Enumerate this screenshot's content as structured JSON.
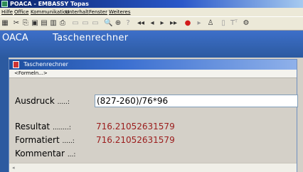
{
  "window": {
    "title": "POACA - EMBASSY Topas"
  },
  "menubar": {
    "items": [
      "Hilfe",
      "Office",
      "Kommunikation",
      "Unterhalt",
      "Fenster",
      "Weiteres"
    ]
  },
  "toolbar": {
    "icons": [
      "grid-icon",
      "cut-icon",
      "copy-icon",
      "paste-icon",
      "table-icon",
      "chart-icon",
      "print-icon",
      "window1-icon",
      "window2-icon",
      "window3-icon",
      "search-icon",
      "zoom-icon",
      "help-icon",
      "first-icon",
      "prev-icon",
      "next-icon",
      "last-icon",
      "record-icon",
      "play-icon",
      "user-icon",
      "doc-icon",
      "text-icon",
      "settings-icon"
    ],
    "glyphs": [
      "▦",
      "✂",
      "⎘",
      "▣",
      "▤",
      "▥",
      "⎙",
      "▭",
      "▭",
      "▭",
      "🔍",
      "⊕",
      "?",
      "◂◂",
      "◂",
      "▸",
      "▸▸",
      "●",
      "▸",
      "♙",
      "▯",
      "Tᵀ",
      "⚙"
    ]
  },
  "app_header": {
    "code": "OACA",
    "title": "Taschenrechner"
  },
  "dialog": {
    "title": "Taschenrechner",
    "menu": "<Formeln...>",
    "expression_label": "Ausdruck",
    "expression_dots": ".....:",
    "expression_value": "(827-260)/76*96",
    "result_label": "Resultat",
    "result_dots": "........:",
    "result_value": "716.21052631579",
    "formatted_label": "Formatiert",
    "formatted_dots": ".....:",
    "formatted_value": "716.21052631579",
    "comment_label": "Kommentar",
    "comment_dots": "...:"
  },
  "colors": {
    "header_blue": "#2c5aa0",
    "result_red": "#9b1c1c"
  }
}
